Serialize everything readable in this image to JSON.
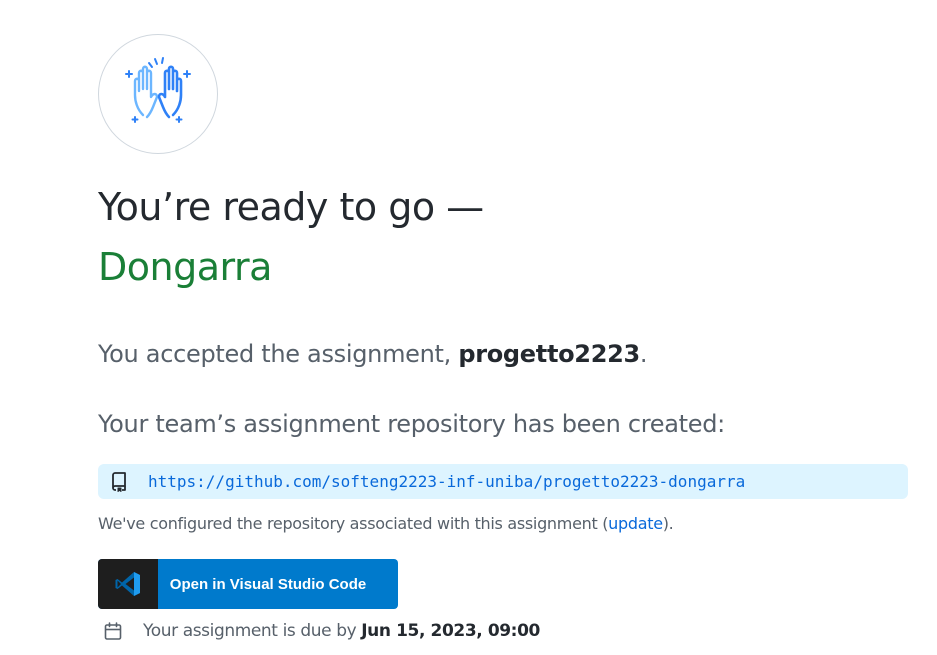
{
  "icons": {
    "high_five": "high-five-hands-icon",
    "repo": "repo-icon",
    "vscode": "vscode-logo-icon",
    "calendar": "calendar-icon"
  },
  "colors": {
    "accent_green": "#1a7f37",
    "link_blue": "#0969da",
    "repo_bg": "#ddf4ff",
    "vscode_blue": "#007acc",
    "vscode_dark": "#1e1e1e"
  },
  "hero": {
    "title": "You’re ready to go —",
    "name": "Dongarra"
  },
  "assignment": {
    "accepted_prefix": "You accepted the assignment, ",
    "name": "progetto2223",
    "accepted_suffix": "."
  },
  "repository": {
    "created_text": "Your team’s assignment repository has been created:",
    "url": "https://github.com/softeng2223-inf-uniba/progetto2223-dongarra",
    "configured_prefix": "We've configured the repository associated with this assignment (",
    "update_link": "update",
    "configured_suffix": ")."
  },
  "actions": {
    "open_vscode_label": "Open in Visual Studio Code"
  },
  "deadline": {
    "prefix": "Your assignment is due by ",
    "date": "Jun 15, 2023, 09:00"
  }
}
